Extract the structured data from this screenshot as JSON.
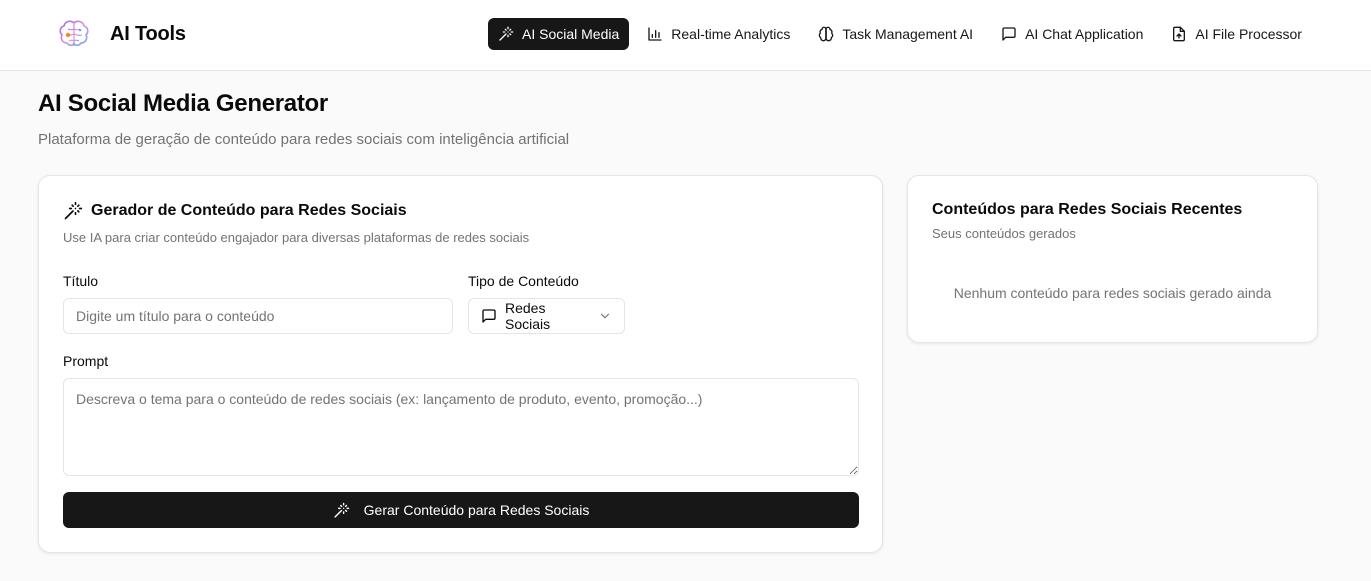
{
  "app": {
    "name": "AI Tools"
  },
  "nav": [
    {
      "label": "AI Social Media",
      "icon": "magic-wand-icon",
      "active": true
    },
    {
      "label": "Real-time Analytics",
      "icon": "bar-chart-icon",
      "active": false
    },
    {
      "label": "Task Management AI",
      "icon": "brain-icon",
      "active": false
    },
    {
      "label": "AI Chat Application",
      "icon": "message-icon",
      "active": false
    },
    {
      "label": "AI File Processor",
      "icon": "file-upload-icon",
      "active": false
    }
  ],
  "page": {
    "title": "AI Social Media Generator",
    "subtitle": "Plataforma de geração de conteúdo para redes sociais com inteligência artificial"
  },
  "generator": {
    "title": "Gerador de Conteúdo para Redes Sociais",
    "description": "Use IA para criar conteúdo engajador para diversas plataformas de redes sociais",
    "title_label": "Título",
    "title_value": "",
    "title_placeholder": "Digite um título para o conteúdo",
    "type_label": "Tipo de Conteúdo",
    "type_value": "Redes Sociais",
    "prompt_label": "Prompt",
    "prompt_value": "",
    "prompt_placeholder": "Descreva o tema para o conteúdo de redes sociais (ex: lançamento de produto, evento, promoção...)",
    "submit_label": "Gerar Conteúdo para Redes Sociais"
  },
  "recent": {
    "title": "Conteúdos para Redes Sociais Recentes",
    "subtitle": "Seus conteúdos gerados",
    "empty": "Nenhum conteúdo para redes sociais gerado ainda"
  },
  "colors": {
    "primary": "#171717",
    "muted": "#737373",
    "border": "#e5e5e5",
    "background": "#fafafa"
  }
}
